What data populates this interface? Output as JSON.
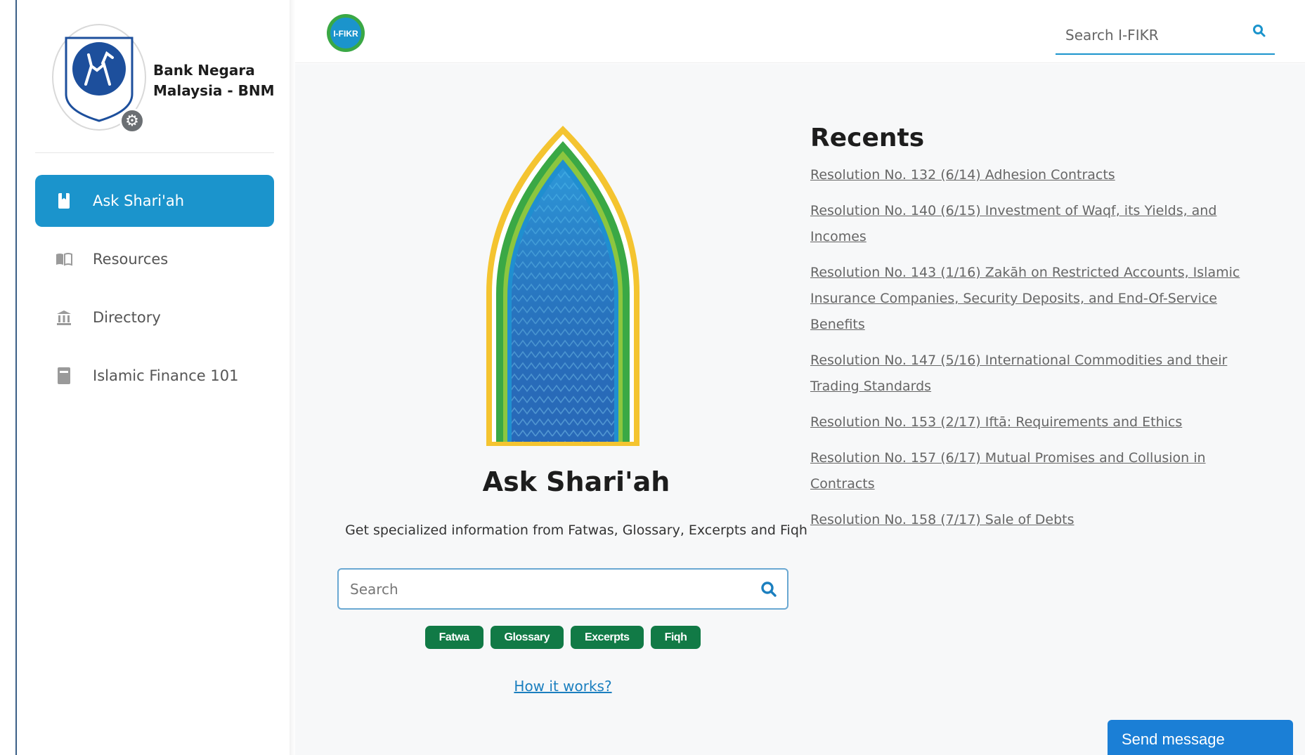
{
  "organization": {
    "name": "Bank Negara Malaysia - BNM"
  },
  "sidebar": {
    "items": [
      {
        "label": "Ask Shari'ah",
        "icon": "book-bookmark-icon",
        "active": true
      },
      {
        "label": "Resources",
        "icon": "open-book-icon",
        "active": false
      },
      {
        "label": "Directory",
        "icon": "bank-building-icon",
        "active": false
      },
      {
        "label": "Islamic Finance 101",
        "icon": "notebook-icon",
        "active": false
      }
    ]
  },
  "header": {
    "logo_text": "I-FIKR",
    "search_placeholder": "Search I-FIKR"
  },
  "main": {
    "title": "Ask Shari'ah",
    "subtitle": "Get specialized information from Fatwas, Glossary, Excerpts and Fiqh",
    "search_placeholder": "Search",
    "chips": [
      "Fatwa",
      "Glossary",
      "Excerpts",
      "Fiqh"
    ],
    "how_link": "How it works?"
  },
  "recents": {
    "title": "Recents",
    "items": [
      "Resolution No. 132 (6/14) Adhesion Contracts",
      "Resolution No. 140 (6/15) Investment of Waqf, its Yields, and Incomes",
      "Resolution No. 143 (1/16) Zakāh on Restricted Accounts, Islamic Insurance Companies, Security Deposits, and End-Of-Service Benefits",
      "Resolution No. 147 (5/16) International Commodities and their Trading Standards",
      "Resolution No. 153 (2/17) Iftā: Requirements and Ethics",
      "Resolution No. 157 (6/17) Mutual Promises and Collusion in Contracts",
      "Resolution No. 158 (7/17) Sale of Debts"
    ]
  },
  "chat": {
    "send_label": "Send message"
  },
  "colors": {
    "accent": "#1b94cc",
    "chip_green": "#117a46",
    "send_blue": "#1b7fd6"
  }
}
